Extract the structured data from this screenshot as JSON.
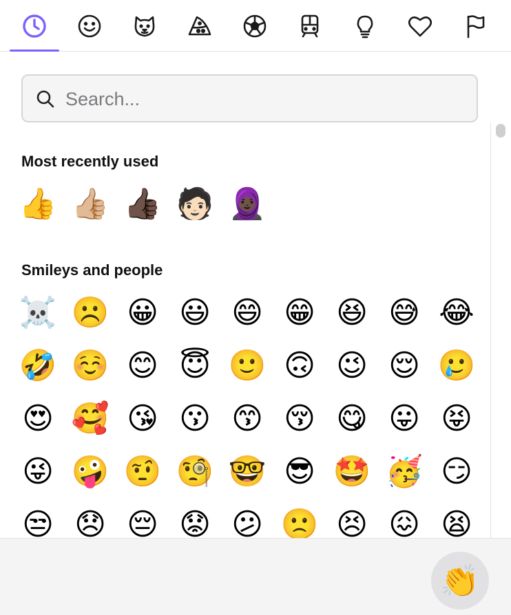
{
  "accent_color": "#7b61ff",
  "tabs": [
    {
      "icon": "clock-icon",
      "label": "Recent",
      "active": true
    },
    {
      "icon": "smiley-icon",
      "label": "Smileys"
    },
    {
      "icon": "animal-icon",
      "label": "Animals"
    },
    {
      "icon": "pizza-icon",
      "label": "Food"
    },
    {
      "icon": "soccer-ball-icon",
      "label": "Activities"
    },
    {
      "icon": "train-icon",
      "label": "Travel"
    },
    {
      "icon": "lightbulb-icon",
      "label": "Objects"
    },
    {
      "icon": "heart-icon",
      "label": "Symbols"
    },
    {
      "icon": "flag-icon",
      "label": "Flags"
    }
  ],
  "search": {
    "placeholder": "Search...",
    "value": ""
  },
  "sections": [
    {
      "title": "Most recently used",
      "emojis": [
        "👍",
        "👍🏼",
        "👍🏿",
        "🧑🏻",
        "🧕🏿"
      ]
    },
    {
      "title": "Smileys and people",
      "emojis": [
        "☠️",
        "☹️",
        "😀",
        "😃",
        "😄",
        "😁",
        "😆",
        "😅",
        "😂",
        "🤣",
        "☺️",
        "😊",
        "😇",
        "🙂",
        "🙃",
        "😉",
        "😌",
        "🥲",
        "😍",
        "🥰",
        "😘",
        "😗",
        "😙",
        "😚",
        "😋",
        "😛",
        "😝",
        "😜",
        "🤪",
        "🤨",
        "🧐",
        "🤓",
        "😎",
        "🤩",
        "🥳",
        "😏",
        "😒",
        "😞",
        "😔",
        "😟",
        "😕",
        "🙁",
        "😣",
        "😖",
        "😫"
      ]
    }
  ],
  "preview": {
    "emoji": "👏"
  }
}
